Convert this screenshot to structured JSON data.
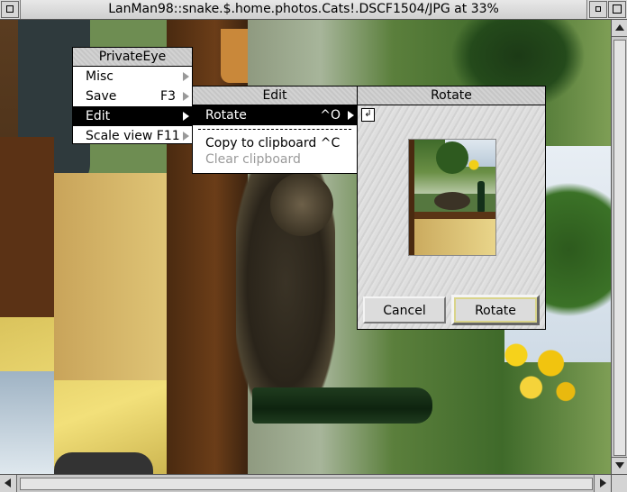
{
  "window": {
    "title": "LanMan98::snake.$.home.photos.Cats!.DSCF1504/JPG at 33%"
  },
  "menus": {
    "main": {
      "title": "PrivateEye",
      "items": [
        {
          "label": "Misc",
          "shortcut": "",
          "submenu": true
        },
        {
          "label": "Save",
          "shortcut": "F3",
          "submenu": true
        },
        {
          "label": "Edit",
          "shortcut": "",
          "submenu": true,
          "selected": true
        },
        {
          "label": "Scale view F11",
          "shortcut": "",
          "submenu": true
        }
      ]
    },
    "edit": {
      "title": "Edit",
      "items": [
        {
          "label": "Rotate",
          "shortcut": "^O",
          "submenu": true,
          "selected": true
        },
        {
          "label": "Copy to clipboard ^C",
          "shortcut": ""
        },
        {
          "label": "Clear clipboard",
          "shortcut": "",
          "shaded": true
        }
      ]
    }
  },
  "rotate_dialog": {
    "title": "Rotate",
    "icon": "rotate-arrow-icon",
    "cancel_label": "Cancel",
    "rotate_label": "Rotate"
  },
  "colors": {
    "menu_highlight": "#000000",
    "shaded_text": "#9a9a9a",
    "default_button_outline": "#d9d48a"
  }
}
